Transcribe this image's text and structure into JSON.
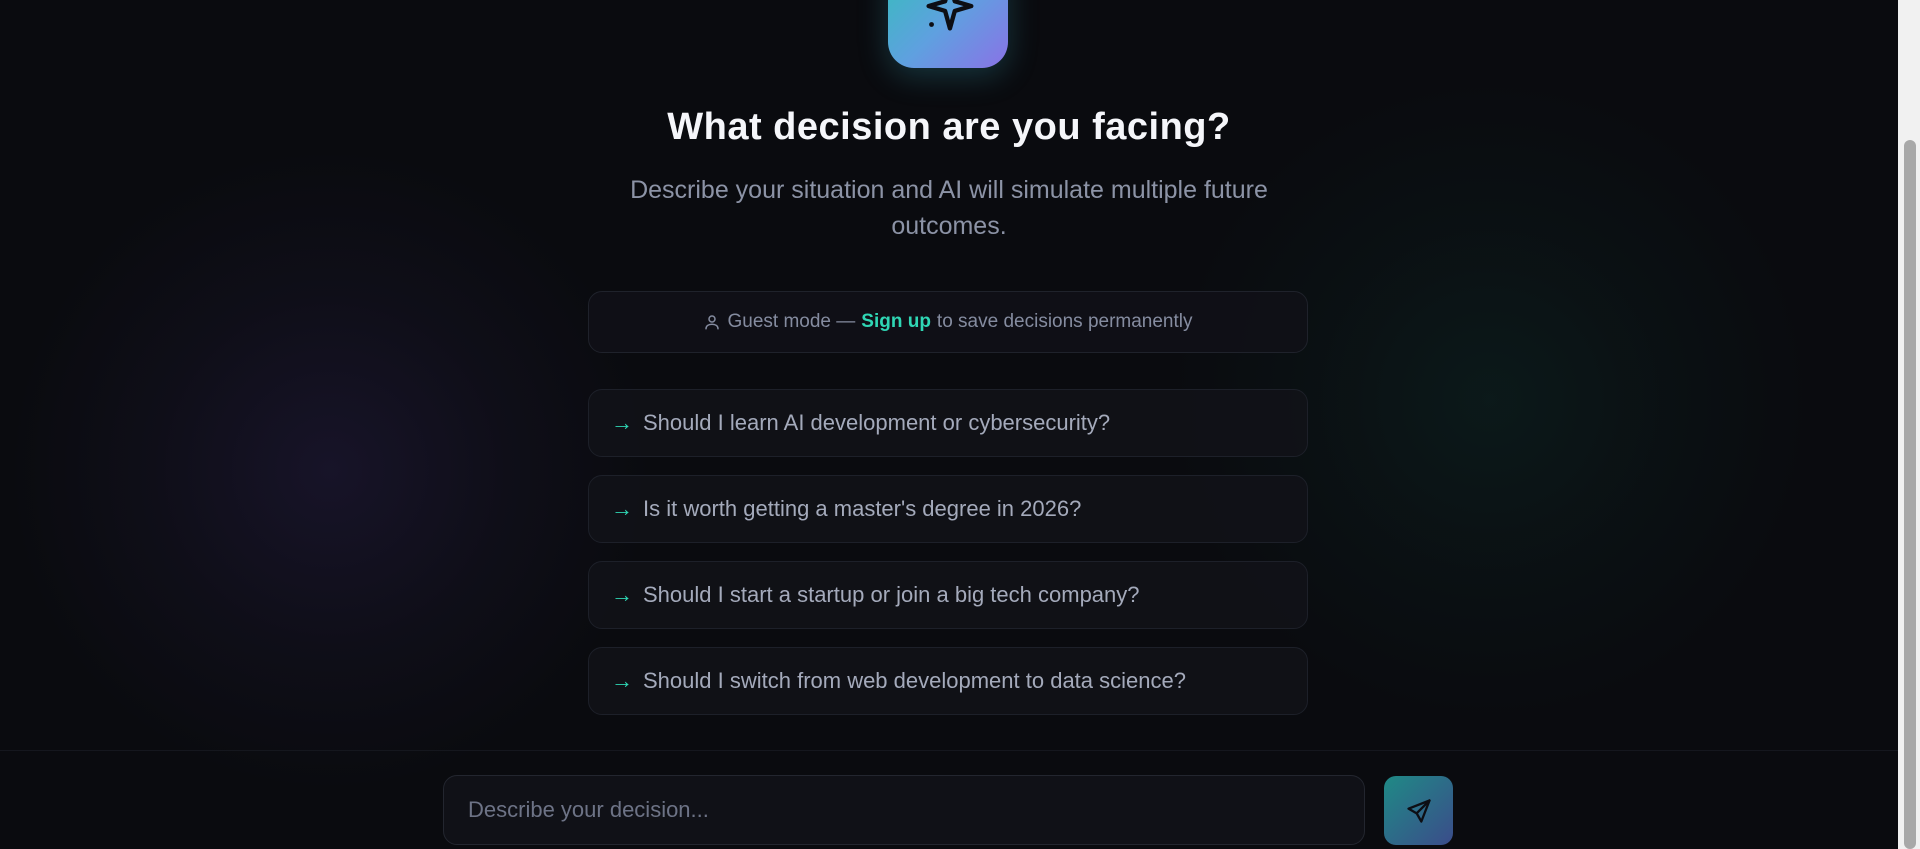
{
  "hero": {
    "icon": "sparkle-icon",
    "title": "What decision are you facing?",
    "subtitle": "Describe your situation and AI will simulate multiple future outcomes."
  },
  "guest_banner": {
    "icon": "user-icon",
    "prefix": "Guest mode —",
    "link_label": "Sign up",
    "suffix": "to save decisions permanently"
  },
  "suggestions": [
    {
      "arrow": "→",
      "text": "Should I learn AI development or cybersecurity?"
    },
    {
      "arrow": "→",
      "text": "Is it worth getting a master's degree in 2026?"
    },
    {
      "arrow": "→",
      "text": "Should I start a startup or join a big tech company?"
    },
    {
      "arrow": "→",
      "text": "Should I switch from web development to data science?"
    }
  ],
  "composer": {
    "value": "",
    "placeholder": "Describe your decision...",
    "send_icon": "send-icon"
  },
  "colors": {
    "accent": "#2fd6b4",
    "background": "#0a0b0f"
  }
}
